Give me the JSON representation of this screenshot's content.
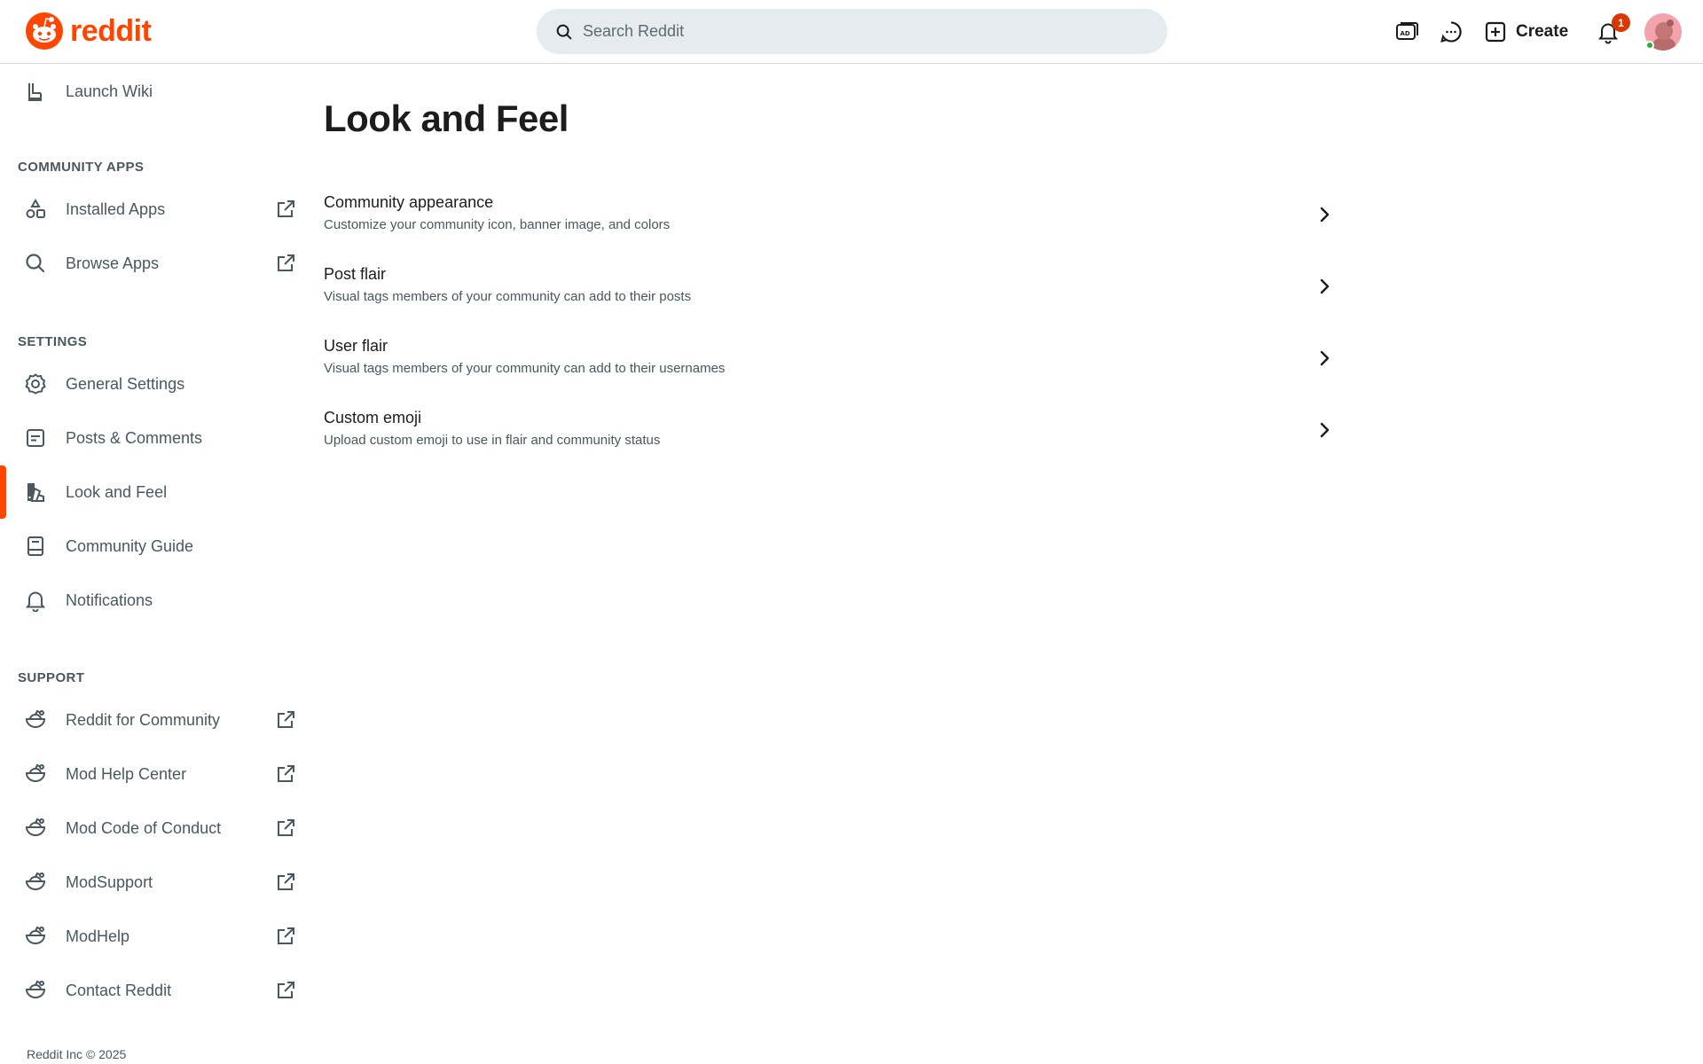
{
  "header": {
    "logo_text": "reddit",
    "search_placeholder": "Search Reddit",
    "create_label": "Create",
    "notification_count": "1",
    "icons": [
      "advertise-icon",
      "chat-icon",
      "create-plus-icon",
      "notification-bell-icon"
    ]
  },
  "sidebar": {
    "top_item": {
      "label": "Launch Wiki",
      "icon": "wiki-icon"
    },
    "community_apps": {
      "title": "COMMUNITY APPS",
      "items": [
        {
          "label": "Installed Apps",
          "icon": "apps-icon",
          "external": true
        },
        {
          "label": "Browse Apps",
          "icon": "search-icon",
          "external": true
        }
      ]
    },
    "settings": {
      "title": "SETTINGS",
      "items": [
        {
          "label": "General Settings",
          "icon": "gear-icon"
        },
        {
          "label": "Posts & Comments",
          "icon": "posts-icon"
        },
        {
          "label": "Look and Feel",
          "icon": "brush-icon",
          "active": true
        },
        {
          "label": "Community Guide",
          "icon": "guide-icon"
        },
        {
          "label": "Notifications",
          "icon": "bell-icon"
        }
      ]
    },
    "support": {
      "title": "SUPPORT",
      "items": [
        {
          "label": "Reddit for Community",
          "icon": "community-bowl-icon",
          "external": true
        },
        {
          "label": "Mod Help Center",
          "icon": "community-bowl-icon",
          "external": true
        },
        {
          "label": "Mod Code of Conduct",
          "icon": "community-bowl-icon",
          "external": true
        },
        {
          "label": "ModSupport",
          "icon": "community-bowl-icon",
          "external": true
        },
        {
          "label": "ModHelp",
          "icon": "community-bowl-icon",
          "external": true
        },
        {
          "label": "Contact Reddit",
          "icon": "community-bowl-icon",
          "external": true
        }
      ]
    },
    "copyright": "Reddit Inc © 2025"
  },
  "main": {
    "title": "Look and Feel",
    "settings": [
      {
        "title": "Community appearance",
        "description": "Customize your community icon, banner image, and colors"
      },
      {
        "title": "Post flair",
        "description": "Visual tags members of your community can add to their posts"
      },
      {
        "title": "User flair",
        "description": "Visual tags members of your community can add to their usernames"
      },
      {
        "title": "Custom emoji",
        "description": "Upload custom emoji to use in flair and community status"
      }
    ]
  },
  "colors": {
    "brand": "#ff4500",
    "badge": "#d93900",
    "search_bg": "#e5ebee",
    "secondary_text": "#4a575e"
  }
}
